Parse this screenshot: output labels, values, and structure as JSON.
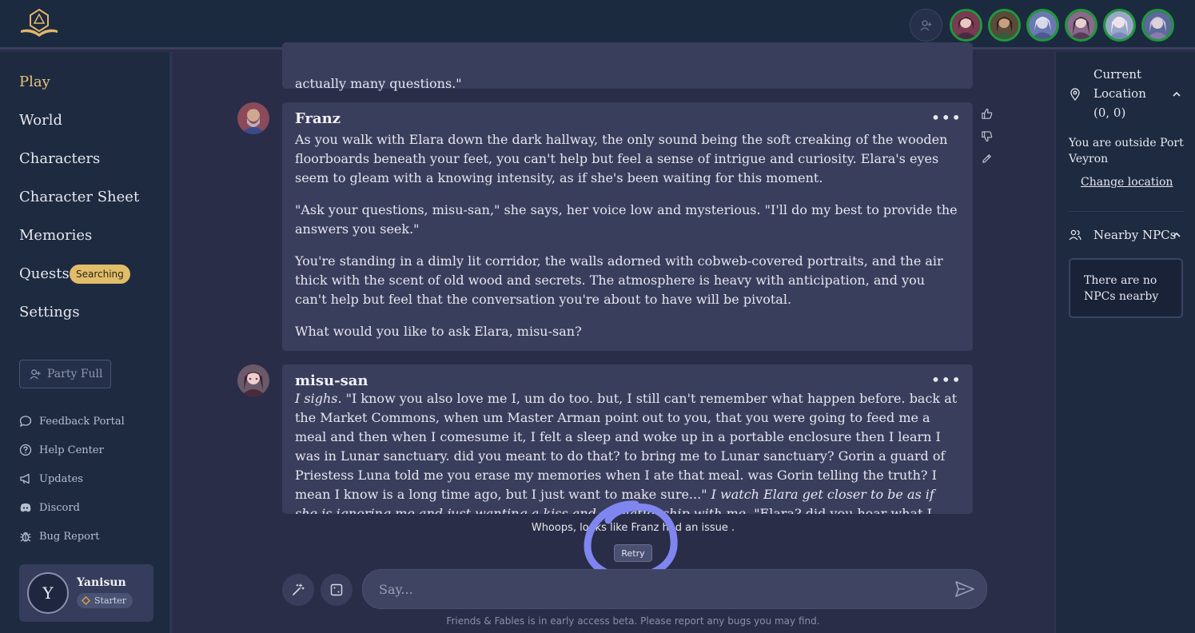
{
  "header": {
    "logo_icon": "d20-book-icon",
    "add_member_icon": "user-plus-icon",
    "party_members": [
      {
        "icon": "character-portrait-1",
        "color": "#7a3a52"
      },
      {
        "icon": "character-portrait-2",
        "color": "#5a4a3a"
      },
      {
        "icon": "character-portrait-3",
        "color": "#6a7ab0"
      },
      {
        "icon": "character-portrait-4",
        "color": "#8a6a8a"
      },
      {
        "icon": "character-portrait-5",
        "color": "#9aa8c8"
      },
      {
        "icon": "character-portrait-6",
        "color": "#5a6a9a"
      }
    ]
  },
  "sidebar": {
    "nav": [
      {
        "label": "Play",
        "active": true
      },
      {
        "label": "World"
      },
      {
        "label": "Characters"
      },
      {
        "label": "Character Sheet"
      },
      {
        "label": "Memories"
      },
      {
        "label": "Quests"
      },
      {
        "label": "Settings"
      }
    ],
    "quests_badge": "Searching",
    "party_button": "Party Full",
    "links": [
      {
        "label": "Feedback Portal",
        "icon": "chat-bubble-icon"
      },
      {
        "label": "Help Center",
        "icon": "question-circle-icon"
      },
      {
        "label": "Updates",
        "icon": "megaphone-icon"
      },
      {
        "label": "Discord",
        "icon": "discord-icon"
      },
      {
        "label": "Bug Report",
        "icon": "bug-icon"
      }
    ],
    "user": {
      "initial": "Y",
      "name": "Yanisun",
      "tier": "Starter"
    }
  },
  "chat": {
    "prev_message_tail": "actually many questions.\"",
    "messages": [
      {
        "author": "Franz",
        "paragraphs": [
          "As you walk with Elara down the dark hallway, the only sound being the soft creaking of the wooden floorboards beneath your feet, you can't help but feel a sense of intrigue and curiosity. Elara's eyes seem to gleam with a knowing intensity, as if she's been waiting for this moment.",
          "\"Ask your questions, misu-san,\" she says, her voice low and mysterious. \"I'll do my best to provide the answers you seek.\"",
          "You're standing in a dimly lit corridor, the walls adorned with cobweb-covered portraits, and the air thick with the scent of old wood and secrets. The atmosphere is heavy with anticipation, and you can't help but feel that the conversation you're about to have will be pivotal.",
          "What would you like to ask Elara, misu-san?"
        ]
      },
      {
        "author": "misu-san",
        "italic_start": "I sighs.",
        "body": " \"I know you also love me I, um do too. but, I still can't remember what happen before. back at the Market Commons, when um Master Arman point out to you, that you were going to feed me a meal and then when I comesume it, I felt a sleep and woke up in a portable enclosure then I learn I was in Lunar sanctuary. did you meant to do that? to bring me to Lunar sanctuary? Gorin a guard of Priestess Luna told me you erase my memories when I ate that meal. was Gorin telling the truth? I mean I know is a long time ago, but I just want to make sure...\" ",
        "italic_end": "I watch Elara get closer to be as if she is ignoring me and just wanting a kiss and a relationship with me.",
        "tail": " \"Elara? did you hear what I said?\""
      }
    ],
    "error_text": "Whoops, looks like Franz had an issue .",
    "retry_label": "Retry",
    "input_placeholder": "Say...",
    "beta_note": "Friends & Fables is in early access beta. Please report any bugs you may find.",
    "annotation_color": "#7f86f0"
  },
  "right_panel": {
    "location_title": "Current Location (0, 0)",
    "location_text": "You are outside Port Veyron",
    "change_location": "Change location",
    "npcs_title": "Nearby NPCs",
    "npcs_empty": "There are no NPCs nearby"
  }
}
